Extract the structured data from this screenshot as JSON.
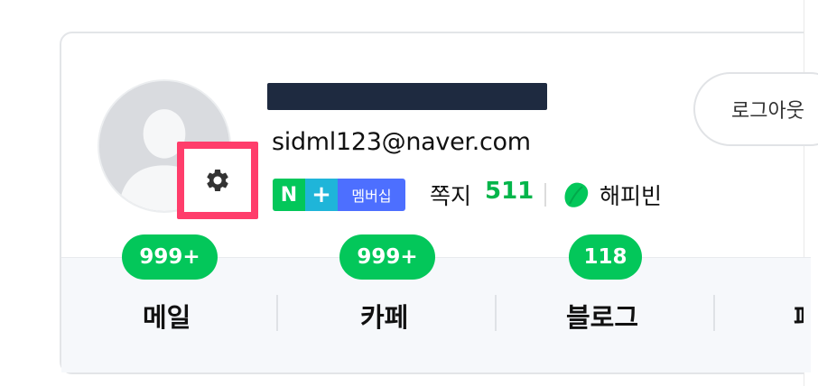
{
  "profile": {
    "email": "sidml123@naver.com",
    "membership": {
      "n": "N",
      "plus": "+",
      "label": "멤버십"
    },
    "note_label": "쪽지",
    "note_count": "511",
    "happybean_label": "해피빈",
    "logout_label": "로그아웃"
  },
  "services": [
    {
      "label": "메일",
      "badge": "999+"
    },
    {
      "label": "카페",
      "badge": "999+"
    },
    {
      "label": "블로그",
      "badge": "118"
    },
    {
      "label": "페",
      "badge": ""
    }
  ],
  "colors": {
    "naver_green": "#03c75a",
    "highlight_border": "#ff3d6b",
    "membership_blue": "#4d6fff",
    "plus_cyan": "#1fb5d9"
  },
  "icons": {
    "gear": "gear-icon",
    "happybean": "bean-icon",
    "avatar": "default-avatar-icon"
  }
}
